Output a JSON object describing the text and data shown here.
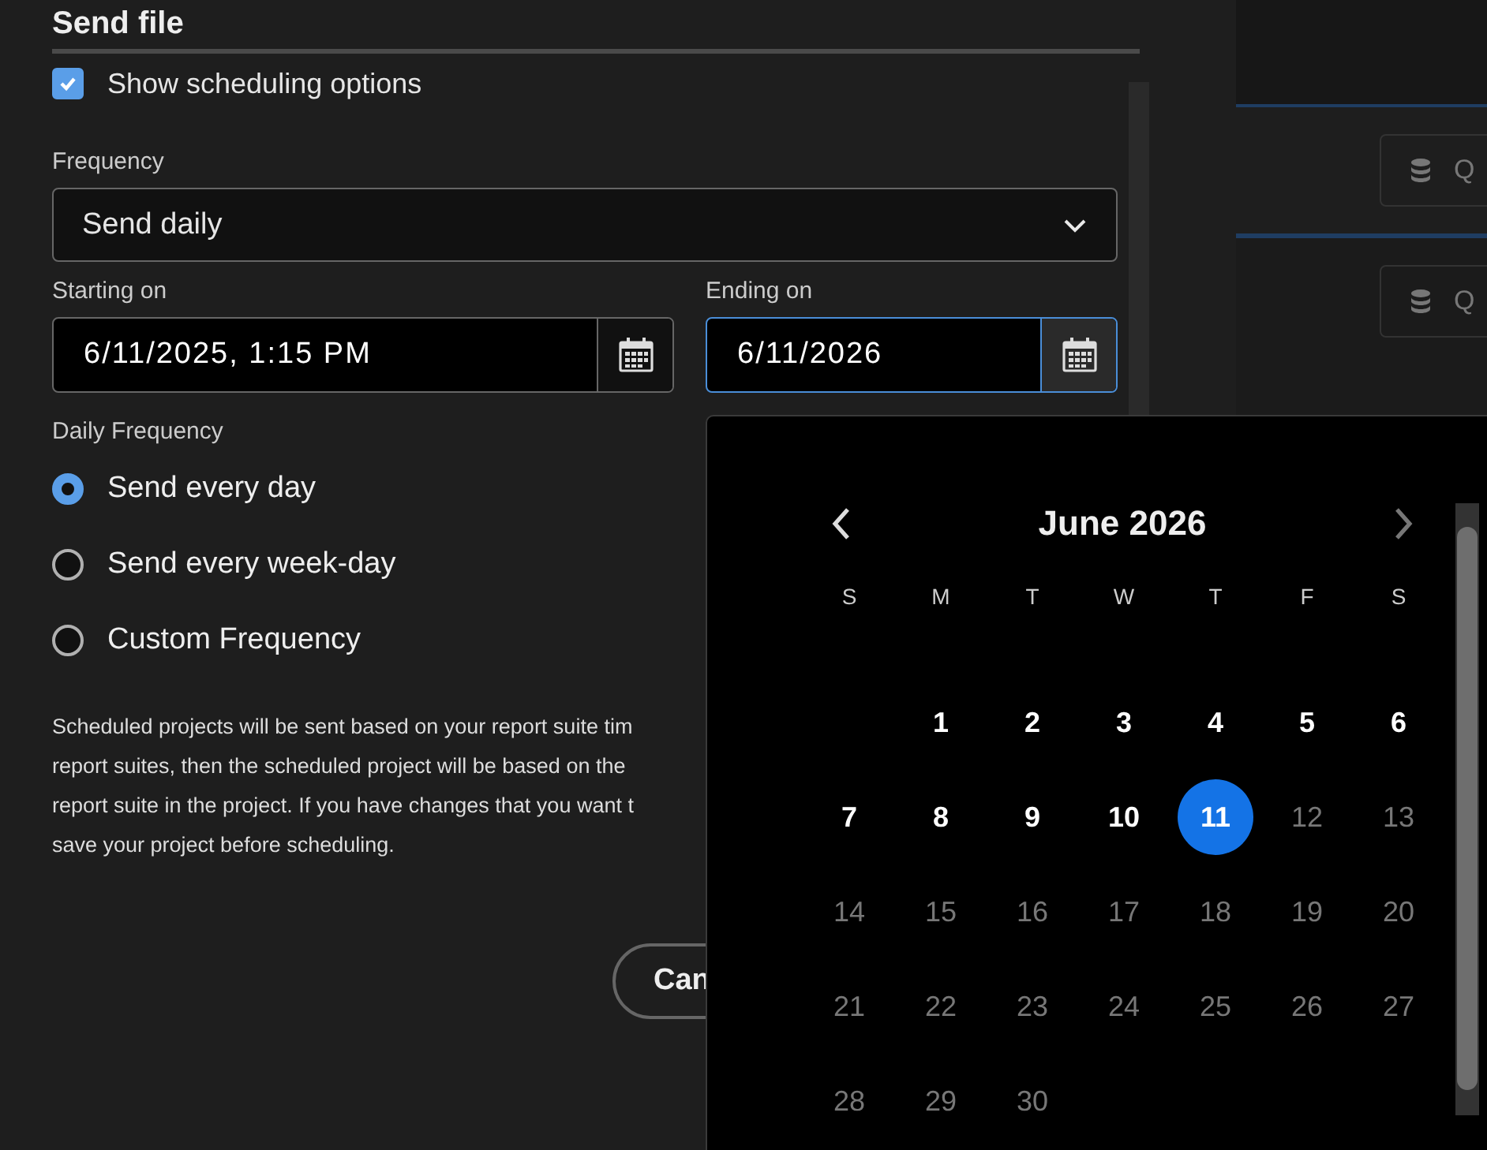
{
  "dialog": {
    "title": "Send file"
  },
  "show_scheduling": {
    "label": "Show scheduling options",
    "checked": true
  },
  "frequency": {
    "label": "Frequency",
    "value": "Send daily"
  },
  "starting_on": {
    "label": "Starting on",
    "value": "6/11/2025, 1:15 PM",
    "focused": false
  },
  "ending_on": {
    "label": "Ending on",
    "value": "6/11/2026",
    "focused": true
  },
  "daily_frequency": {
    "label": "Daily Frequency",
    "options": [
      {
        "label": "Send every day",
        "selected": true
      },
      {
        "label": "Send every week-day",
        "selected": false
      },
      {
        "label": "Custom Frequency",
        "selected": false
      }
    ]
  },
  "note": {
    "lines": [
      "Scheduled projects will be sent based on your report suite tim",
      "report suites, then the scheduled project will be based on the",
      "report suite in the project. If you have changes that you want t",
      "save your project before scheduling."
    ]
  },
  "cancel_button": "Can",
  "background_fields": [
    {
      "text": "Q"
    },
    {
      "text": "Q"
    }
  ],
  "calendar": {
    "month": "June 2026",
    "prev_disabled": false,
    "next_disabled": true,
    "weekdays": [
      "S",
      "M",
      "T",
      "W",
      "T",
      "F",
      "S"
    ],
    "weeks": [
      [
        {
          "label": "1",
          "selected": false,
          "disabled": false
        },
        {
          "label": "2",
          "selected": false,
          "disabled": false
        },
        {
          "label": "3",
          "selected": false,
          "disabled": false
        },
        {
          "label": "4",
          "selected": false,
          "disabled": false
        },
        {
          "label": "5",
          "selected": false,
          "disabled": false
        },
        {
          "label": "6",
          "selected": false,
          "disabled": false
        }
      ],
      [
        {
          "label": "7",
          "selected": false,
          "disabled": false
        },
        {
          "label": "8",
          "selected": false,
          "disabled": false
        },
        {
          "label": "9",
          "selected": false,
          "disabled": false
        },
        {
          "label": "10",
          "selected": false,
          "disabled": false
        },
        {
          "label": "11",
          "selected": true,
          "disabled": false
        },
        {
          "label": "12",
          "selected": false,
          "disabled": true
        },
        {
          "label": "13",
          "selected": false,
          "disabled": true
        }
      ],
      [
        {
          "label": "14",
          "selected": false,
          "disabled": true
        },
        {
          "label": "15",
          "selected": false,
          "disabled": true
        },
        {
          "label": "16",
          "selected": false,
          "disabled": true
        },
        {
          "label": "17",
          "selected": false,
          "disabled": true
        },
        {
          "label": "18",
          "selected": false,
          "disabled": true
        },
        {
          "label": "19",
          "selected": false,
          "disabled": true
        },
        {
          "label": "20",
          "selected": false,
          "disabled": true
        }
      ],
      [
        {
          "label": "21",
          "selected": false,
          "disabled": true
        },
        {
          "label": "22",
          "selected": false,
          "disabled": true
        },
        {
          "label": "23",
          "selected": false,
          "disabled": true
        },
        {
          "label": "24",
          "selected": false,
          "disabled": true
        },
        {
          "label": "25",
          "selected": false,
          "disabled": true
        },
        {
          "label": "26",
          "selected": false,
          "disabled": true
        },
        {
          "label": "27",
          "selected": false,
          "disabled": true
        }
      ],
      [
        {
          "label": "28",
          "selected": false,
          "disabled": true
        },
        {
          "label": "29",
          "selected": false,
          "disabled": true
        },
        {
          "label": "30",
          "selected": false,
          "disabled": true
        }
      ]
    ]
  }
}
